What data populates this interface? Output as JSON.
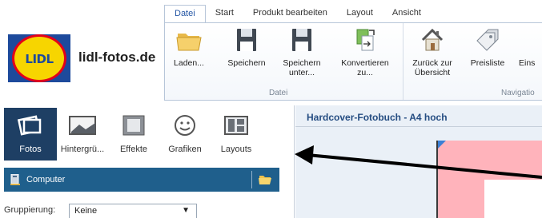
{
  "ribbon": {
    "tabs": [
      "Datei",
      "Start",
      "Produkt bearbeiten",
      "Layout",
      "Ansicht"
    ],
    "active_tab": "Datei",
    "groups": {
      "datei": {
        "label": "Datei",
        "buttons": [
          {
            "label": "Laden...",
            "icon": "folder-icon"
          },
          {
            "label": "Speichern",
            "icon": "floppy-disk-icon"
          },
          {
            "label": "Speichern unter...",
            "icon": "floppy-disk-icon"
          },
          {
            "label": "Konvertieren zu...",
            "icon": "convert-document-icon"
          }
        ]
      },
      "navigation": {
        "label": "Navigatio",
        "buttons": [
          {
            "label": "Zurück zur Übersicht",
            "icon": "home-icon"
          },
          {
            "label": "Preisliste",
            "icon": "price-tag-icon"
          },
          {
            "label": "Eins",
            "icon": ""
          }
        ]
      }
    }
  },
  "logo": {
    "text": "LIDL",
    "brand": "lidl-fotos.de"
  },
  "left_panel": {
    "tools": [
      {
        "label": "Fotos",
        "icon": "photos-icon",
        "active": true
      },
      {
        "label": "Hintergrü...",
        "icon": "background-icon",
        "active": false
      },
      {
        "label": "Effekte",
        "icon": "frame-effect-icon",
        "active": false
      },
      {
        "label": "Grafiken",
        "icon": "smiley-icon",
        "active": false
      },
      {
        "label": "Layouts",
        "icon": "layout-icon",
        "active": false
      }
    ],
    "source": {
      "label": "Computer"
    },
    "grouping": {
      "label": "Gruppierung:",
      "value": "Keine"
    }
  },
  "document": {
    "title": "Hardcover-Fotobuch - A4 hoch"
  },
  "colors": {
    "active_tile": "#1e3f64",
    "source_bar": "#1f5f8c",
    "canvas_pink": "#ffb3bb",
    "title_text": "#254d82"
  }
}
